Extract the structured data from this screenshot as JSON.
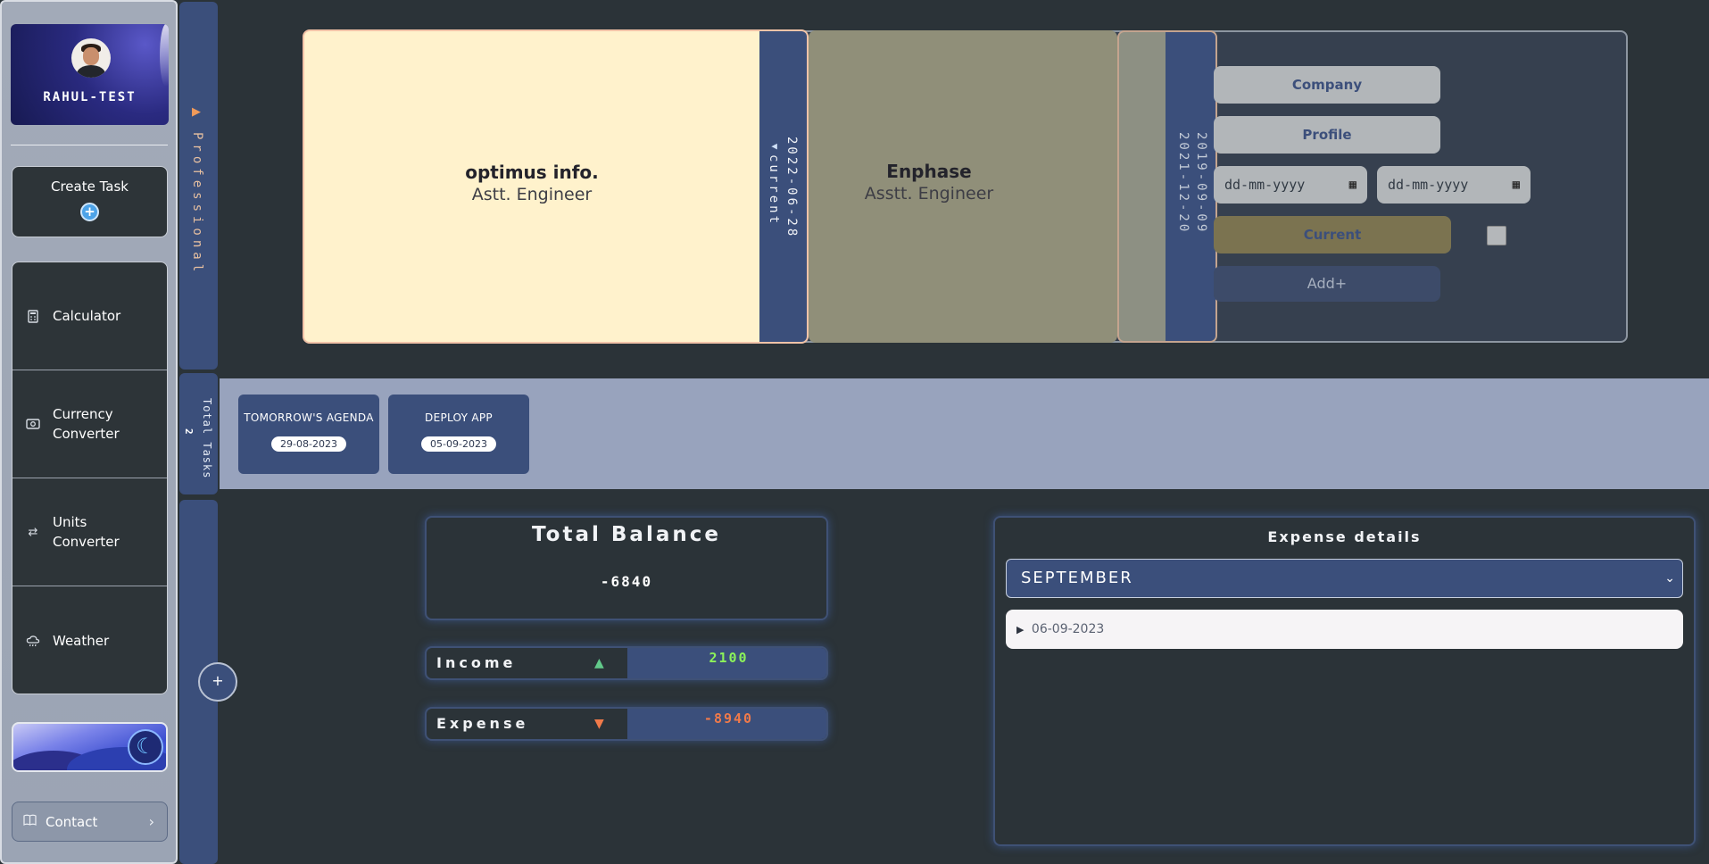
{
  "sidebar": {
    "profile_name": "RAHUL-TEST",
    "create_task_label": "Create Task",
    "tools": [
      {
        "label": "Calculator",
        "icon": "calculator-icon"
      },
      {
        "label": "Currency Converter",
        "icon": "currency-icon"
      },
      {
        "label": "Units Converter",
        "icon": "swap-icon"
      },
      {
        "label": "Weather",
        "icon": "cloud-rain-icon"
      }
    ],
    "contact_label": "Contact"
  },
  "professional": {
    "section_label": "Professional",
    "jobs": [
      {
        "company": "optimus info.",
        "role": "Astt. Engineer",
        "start": "2022-06-28",
        "end": "current"
      },
      {
        "company": "Enphase",
        "role": "Asstt. Engineer",
        "start": "2019-09-09",
        "end": "2021-12-20"
      }
    ],
    "form": {
      "company_label": "Company",
      "profile_label": "Profile",
      "date_placeholder": "dd-mm-yyyy",
      "current_label": "Current",
      "add_label": "Add+"
    }
  },
  "tasks": {
    "label": "Total Tasks",
    "count": "2",
    "items": [
      {
        "name": "TOMORROW'S AGENDA",
        "date": "29-08-2023"
      },
      {
        "name": "DEPLOY APP",
        "date": "05-09-2023"
      }
    ]
  },
  "balance": {
    "add_label": "+",
    "total_title": "Total Balance",
    "total_value": "-6840",
    "income_label": "Income",
    "income_value": "2100",
    "expense_label": "Expense",
    "expense_value": "-8940"
  },
  "expenses": {
    "title": "Expense details",
    "selected_month": "SEPTEMBER",
    "entries": [
      "06-09-2023"
    ]
  },
  "colors": {
    "accent": "#3b4f7b",
    "income": "#8cf25a",
    "expense": "#f07a4a",
    "current_card": "#fff2cc"
  }
}
